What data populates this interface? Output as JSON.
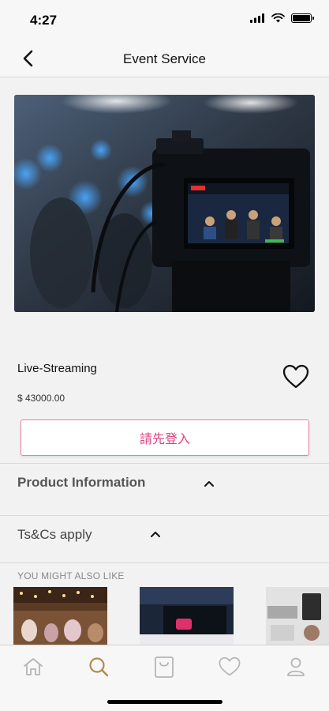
{
  "status_bar": {
    "time": "4:27",
    "icons": [
      "signal-icon",
      "wifi-icon",
      "battery-icon"
    ]
  },
  "nav": {
    "title": "Event Service",
    "back_icon": "chevron-left-icon"
  },
  "product": {
    "name": "Live-Streaming",
    "price": "$ 43000.00",
    "login_button": "請先登入",
    "favorite_icon": "heart-outline-icon"
  },
  "sections": {
    "product_information": "Product Information",
    "terms": "Ts&Cs apply"
  },
  "recommendations": {
    "heading": "YOU MIGHT ALSO LIKE"
  },
  "tabs": [
    {
      "name": "home",
      "icon": "home-icon",
      "active": false
    },
    {
      "name": "search",
      "icon": "search-icon",
      "active": true
    },
    {
      "name": "cart",
      "icon": "bag-icon",
      "active": false
    },
    {
      "name": "wishlist",
      "icon": "heart-icon",
      "active": false
    },
    {
      "name": "profile",
      "icon": "user-icon",
      "active": false
    }
  ],
  "colors": {
    "accent": "#e1427f",
    "active_tab": "#b08a4e",
    "inactive_tab": "#b5b5b5"
  }
}
